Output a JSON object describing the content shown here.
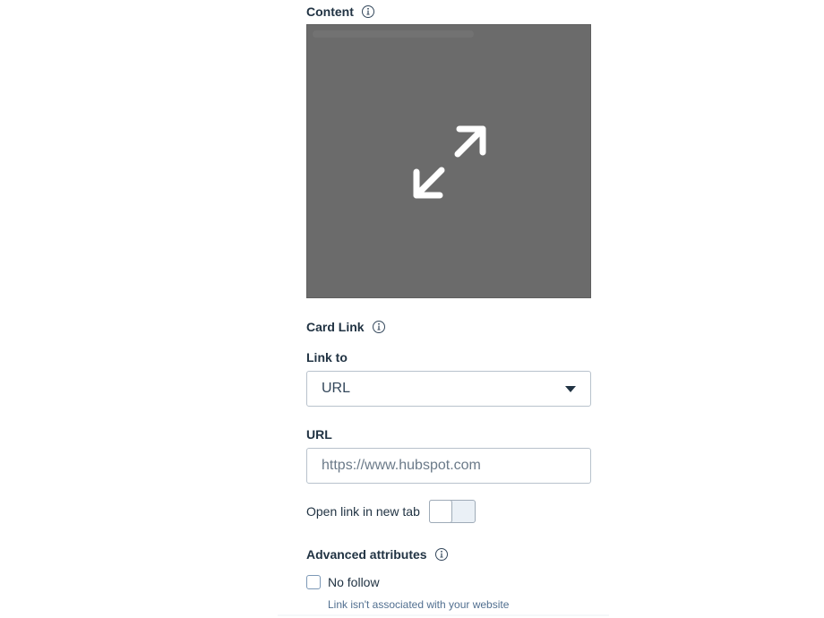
{
  "content": {
    "label": "Content",
    "preview_icon": "expand-icon"
  },
  "card_link": {
    "label": "Card Link"
  },
  "link_to": {
    "label": "Link to",
    "selected": "URL"
  },
  "url": {
    "label": "URL",
    "placeholder": "https://www.hubspot.com"
  },
  "open_new_tab": {
    "label": "Open link in new tab",
    "enabled": false
  },
  "advanced": {
    "label": "Advanced attributes",
    "no_follow": {
      "label": "No follow",
      "checked": false,
      "help": "Link isn't associated with your website"
    }
  },
  "colors": {
    "preview_bg": "#6b6b6b",
    "text_dark": "#213343",
    "border": "#b8c2cc"
  }
}
